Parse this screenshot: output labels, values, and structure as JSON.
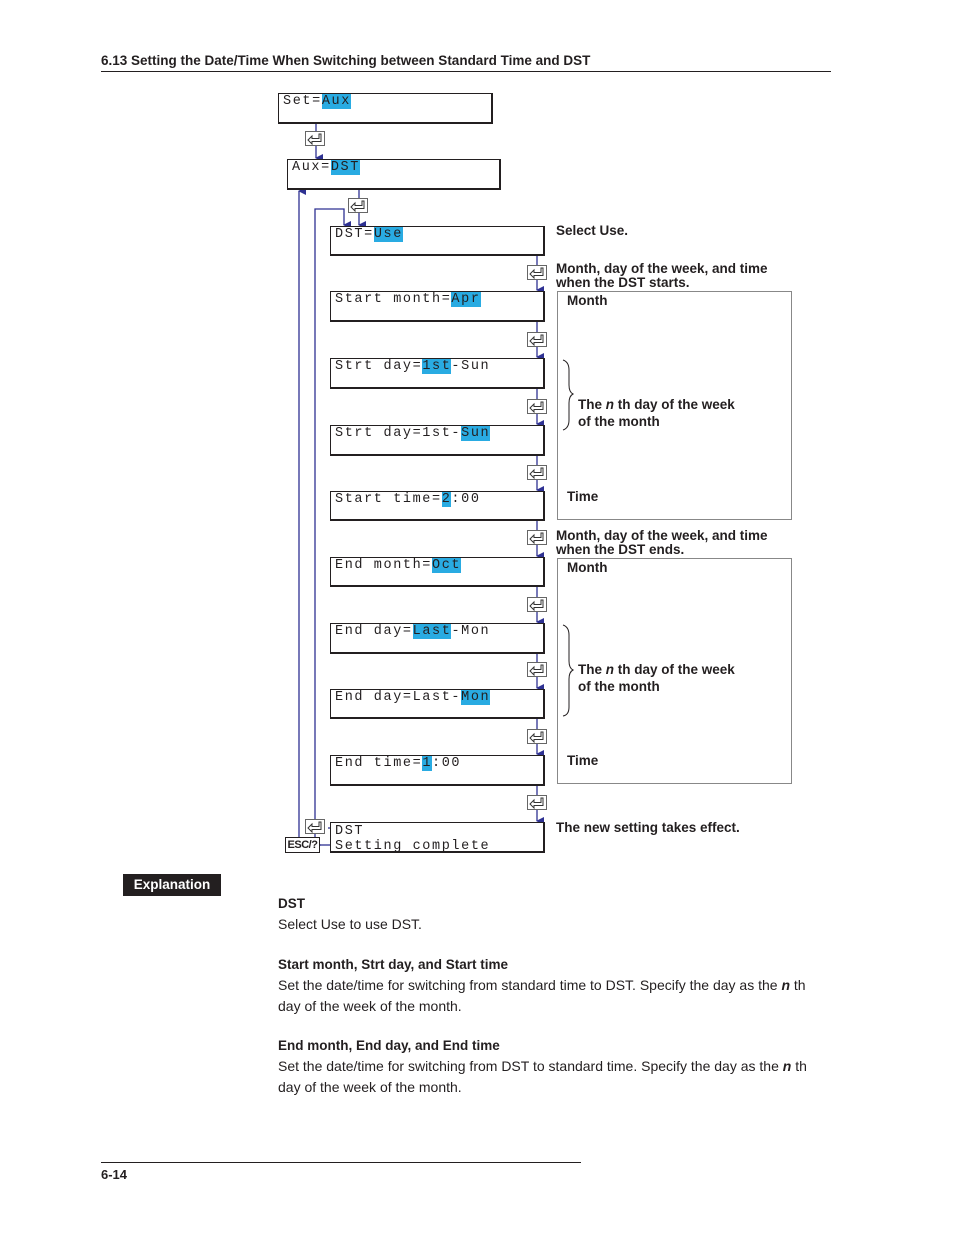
{
  "header": {
    "title": "6.13  Setting the Date/Time When Switching between Standard Time and DST"
  },
  "footer": {
    "page_number": "6-14"
  },
  "colors": {
    "highlight": "#29abe2",
    "flow_line": "#2e3192",
    "text": "#231f20"
  },
  "flow": {
    "screens": [
      {
        "id": "set-aux",
        "segments": [
          [
            "Set=",
            false
          ],
          [
            "Aux",
            true
          ]
        ]
      },
      {
        "id": "aux-dst",
        "segments": [
          [
            "Aux=",
            false
          ],
          [
            "DST",
            true
          ]
        ]
      },
      {
        "id": "dst-use",
        "segments": [
          [
            "DST=",
            false
          ],
          [
            "Use",
            true
          ]
        ]
      },
      {
        "id": "start-month",
        "segments": [
          [
            "Start month=",
            false
          ],
          [
            "Apr",
            true
          ]
        ]
      },
      {
        "id": "strt-day-nth",
        "segments": [
          [
            "Strt day=",
            false
          ],
          [
            "1st",
            true
          ],
          [
            "-Sun",
            false
          ]
        ]
      },
      {
        "id": "strt-day-week",
        "segments": [
          [
            "Strt day=1st-",
            false
          ],
          [
            "Sun",
            true
          ]
        ]
      },
      {
        "id": "start-time",
        "segments": [
          [
            "Start time=",
            false
          ],
          [
            "2",
            true
          ],
          [
            ":00",
            false
          ]
        ]
      },
      {
        "id": "end-month",
        "segments": [
          [
            "End month=",
            false
          ],
          [
            "Oct",
            true
          ]
        ]
      },
      {
        "id": "end-day-nth",
        "segments": [
          [
            "End day=",
            false
          ],
          [
            "Last",
            true
          ],
          [
            "-Mon",
            false
          ]
        ]
      },
      {
        "id": "end-day-week",
        "segments": [
          [
            "End day=Last-",
            false
          ],
          [
            "Mon",
            true
          ]
        ]
      },
      {
        "id": "end-time",
        "segments": [
          [
            "End time=",
            false
          ],
          [
            "1",
            true
          ],
          [
            ":00",
            false
          ]
        ]
      }
    ],
    "complete_screen": {
      "line1": "DST",
      "line2": "Setting complete"
    },
    "enter_key_icon": "enter-key-icon",
    "esc_key_label": "ESC/?"
  },
  "notes": {
    "select_use": "Select Use.",
    "start_heading_1": "Month, day of the week, and time",
    "start_heading_2": "when the DST starts.",
    "end_heading_1": "Month, day of the week, and time",
    "end_heading_2": "when the DST ends.",
    "month": "Month",
    "nth_prefix": "The ",
    "nth_n": "n",
    "nth_suffix": " th day of the week",
    "nth_line2": "of the month",
    "time": "Time",
    "takes_effect": "The new setting takes effect."
  },
  "explanation": {
    "badge": "Explanation",
    "sections": [
      {
        "heading": "DST",
        "lines": [
          "Select Use to use DST."
        ]
      },
      {
        "heading": "Start month, Strt day, and Start time",
        "text_before_n": "Set the date/time for switching from standard time to DST. Specify the day as the ",
        "n": "n",
        "text_after_n": " th",
        "line2": "day of the week of the month."
      },
      {
        "heading": "End month, End day, and End time",
        "text_before_n": "Set the date/time for switching from DST to standard time. Specify the day as the ",
        "n": "n",
        "text_after_n": " th",
        "line2": "day of the week of the month."
      }
    ]
  }
}
